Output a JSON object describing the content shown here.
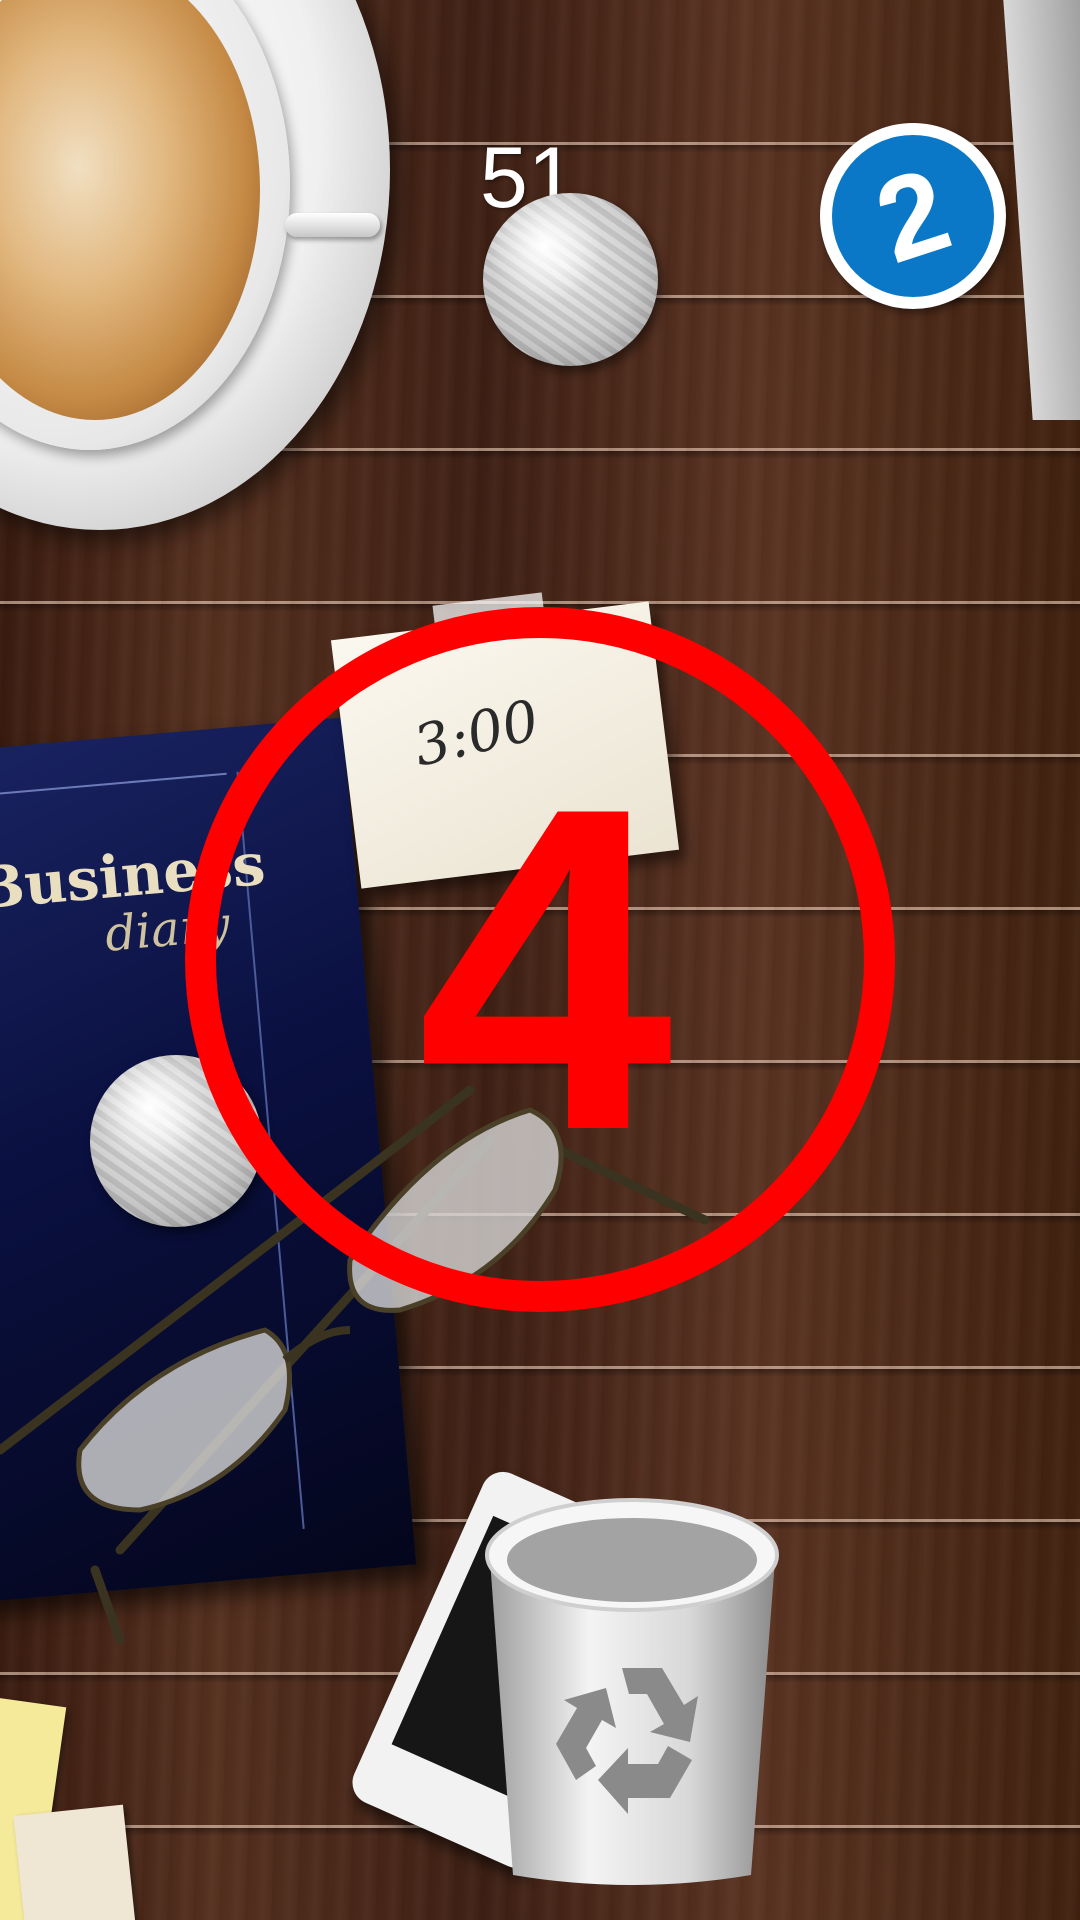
{
  "hud": {
    "score": "51",
    "level": "2"
  },
  "hint": {
    "number": "4",
    "color": "#ff0000"
  },
  "desk_items": {
    "note_text": "3:00",
    "diary_title": "Business",
    "diary_subtitle": "diary"
  },
  "icons": {
    "level_badge": "circled-number-icon",
    "bin": "recycle-bin-icon",
    "paper_ball": "crumpled-paper-ball-icon"
  },
  "colors": {
    "level_badge_blue": "#0a78c6",
    "desk_wood": "#4a2818"
  }
}
